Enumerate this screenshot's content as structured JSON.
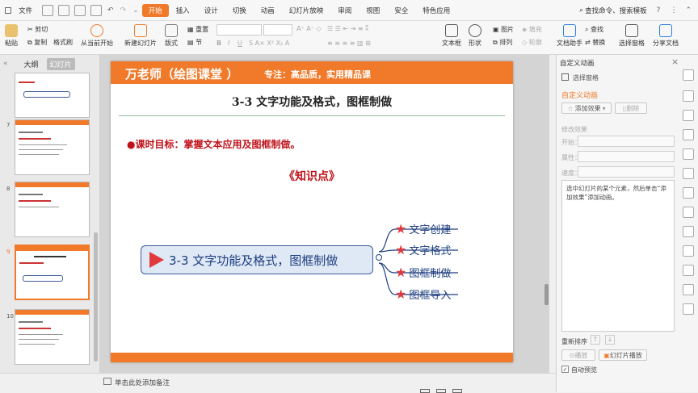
{
  "menubar": {
    "file": "文件",
    "tabs": [
      "开始",
      "插入",
      "设计",
      "切换",
      "动画",
      "幻灯片放映",
      "审阅",
      "视图",
      "安全",
      "特色应用"
    ],
    "active_tab": "开始",
    "search": "查找命令、搜索模板"
  },
  "ribbon": {
    "paste": "粘贴",
    "cut": "剪切",
    "copy": "复制",
    "format_painter": "格式刷",
    "from_current": "从当前开始",
    "new_slide": "新建幻灯片",
    "layout": "版式",
    "section": "节",
    "reset": "重置",
    "text_box": "文本框",
    "shape": "形状",
    "arrange": "排列",
    "picture": "图片",
    "fill": "填充",
    "outline": "轮廓",
    "doc_helper": "文档助手",
    "find": "查找",
    "replace": "替换",
    "select_pane": "选择窗格",
    "share_doc": "分享文档"
  },
  "leftpane": {
    "tab_outline": "大纲",
    "tab_slides": "幻灯片",
    "slide_numbers": [
      "7",
      "8",
      "9",
      "10"
    ],
    "add_icon": "plus-icon"
  },
  "slide": {
    "header_title": "万老师（绘图课堂 ）",
    "header_subtitle": "专注：高品质，实用精品课",
    "title": "3-3 文字功能及格式，图框制做",
    "goal": "●课时目标：掌握文本应用及图框制做。",
    "knowledge": "《知识点》",
    "central_topic": "3-3 文字功能及格式，图框制做",
    "branches": [
      "文字创建",
      "文字格式",
      "图框制做",
      "图框导入"
    ],
    "colors": {
      "header": "#f07a2a",
      "accent": "#e0393e",
      "topic_fill": "#dfe8f5",
      "topic_border": "#3f5c9a"
    }
  },
  "statusbar": {
    "notes": "单击此处添加备注"
  },
  "rightpane": {
    "title": "自定义动画",
    "select_pane": "选择窗格",
    "section_title": "自定义动画",
    "add_effect": "添加效果",
    "delete": "删除",
    "modify_effect": "修改效果",
    "start": "开始：",
    "property": "属性：",
    "speed": "速度：",
    "hint": "选中幻灯片的某个元素，然后单击“添加效果”添加动画。",
    "reorder": "重新排序",
    "play": "播放",
    "slideshow": "幻灯片播放",
    "auto_preview": "自动预览",
    "auto_preview_checked": true
  }
}
